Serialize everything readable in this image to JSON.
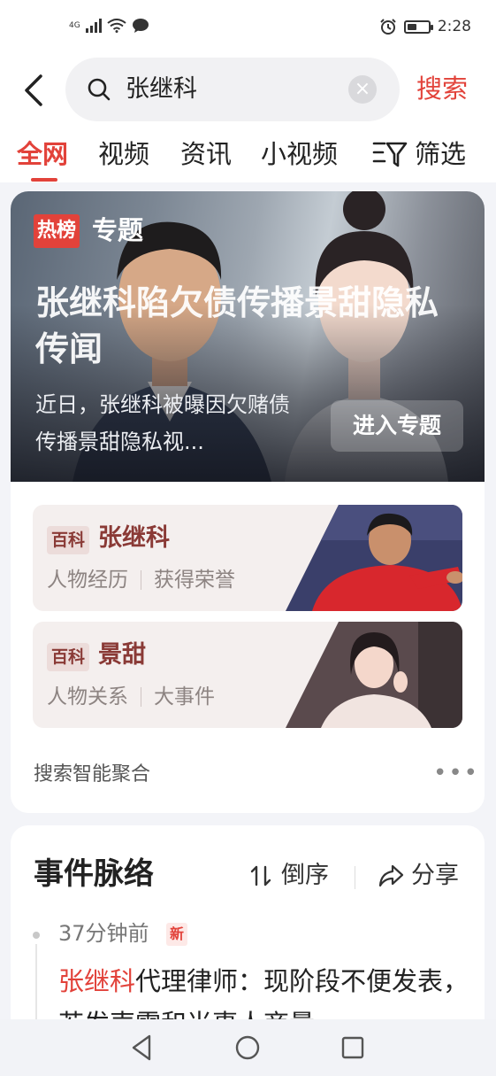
{
  "status_bar": {
    "network": "4G",
    "time": "2:28",
    "battery_level": 0.45,
    "icons": [
      "signal-icon",
      "wifi-icon",
      "message-icon",
      "alarm-icon",
      "battery-icon"
    ]
  },
  "header": {
    "back_icon": "back-arrow-icon",
    "search_query": "张继科",
    "search_button": "搜索"
  },
  "tabs": [
    {
      "label": "全网",
      "active": true
    },
    {
      "label": "视频",
      "active": false
    },
    {
      "label": "资讯",
      "active": false
    },
    {
      "label": "小视频",
      "active": false
    }
  ],
  "filter_label": "筛选",
  "hero": {
    "badge_rebang": "热榜",
    "badge_topic": "专题",
    "title": "张继科陷欠债传播景甜隐私传闻",
    "description": "近日，张继科被曝因欠赌债传播景甜隐私视...",
    "enter_button": "进入专题"
  },
  "baike": [
    {
      "tag": "百科",
      "name": "张继科",
      "links": [
        "人物经历",
        "获得荣誉"
      ]
    },
    {
      "tag": "百科",
      "name": "景甜",
      "links": [
        "人物关系",
        "大事件"
      ]
    }
  ],
  "aggregation_label": "搜索智能聚合",
  "more_label": "•••",
  "event": {
    "title": "事件脉络",
    "sort_label": "倒序",
    "share_label": "分享",
    "item": {
      "time": "37分钟前",
      "new_badge": "新",
      "headline_highlight": "张继科",
      "headline_rest": "代理律师：现阶段不便发表，若发声需和当事人商量"
    }
  },
  "colors": {
    "accent": "#e2423a",
    "baike_bg": "#f4efee",
    "baike_text": "#8a3a36"
  }
}
